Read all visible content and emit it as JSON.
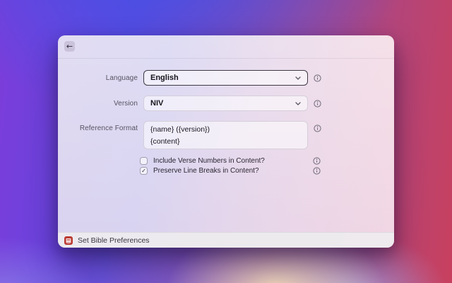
{
  "window": {
    "back_glyph": "←"
  },
  "form": {
    "fields": [
      {
        "label": "Language",
        "value": "English",
        "type": "dropdown",
        "focused": true
      },
      {
        "label": "Version",
        "value": "NIV",
        "type": "dropdown",
        "focused": false
      },
      {
        "label": "Reference Format",
        "type": "textarea",
        "lines": {
          "0": "{name} ({version})",
          "1": "{content}"
        }
      }
    ],
    "checkboxes": [
      {
        "label": "Include Verse Numbers in Content?",
        "checked": false,
        "glyph": ""
      },
      {
        "label": "Preserve Line Breaks in Content?",
        "checked": true,
        "glyph": "✓"
      }
    ]
  },
  "footer": {
    "command_name": "Set Bible Preferences",
    "icon": "bible-book-icon"
  },
  "colors": {
    "focus_border": "#3f3a46",
    "field_border": "#d5cfd9",
    "label_text": "#57525f",
    "value_text": "#17141c",
    "info_icon": "#6f6a78",
    "footer_icon_red": "#bb3a31",
    "bg_purple": "#7d3cda",
    "bg_blue": "#5d49e0",
    "bg_red": "#c8405e"
  }
}
